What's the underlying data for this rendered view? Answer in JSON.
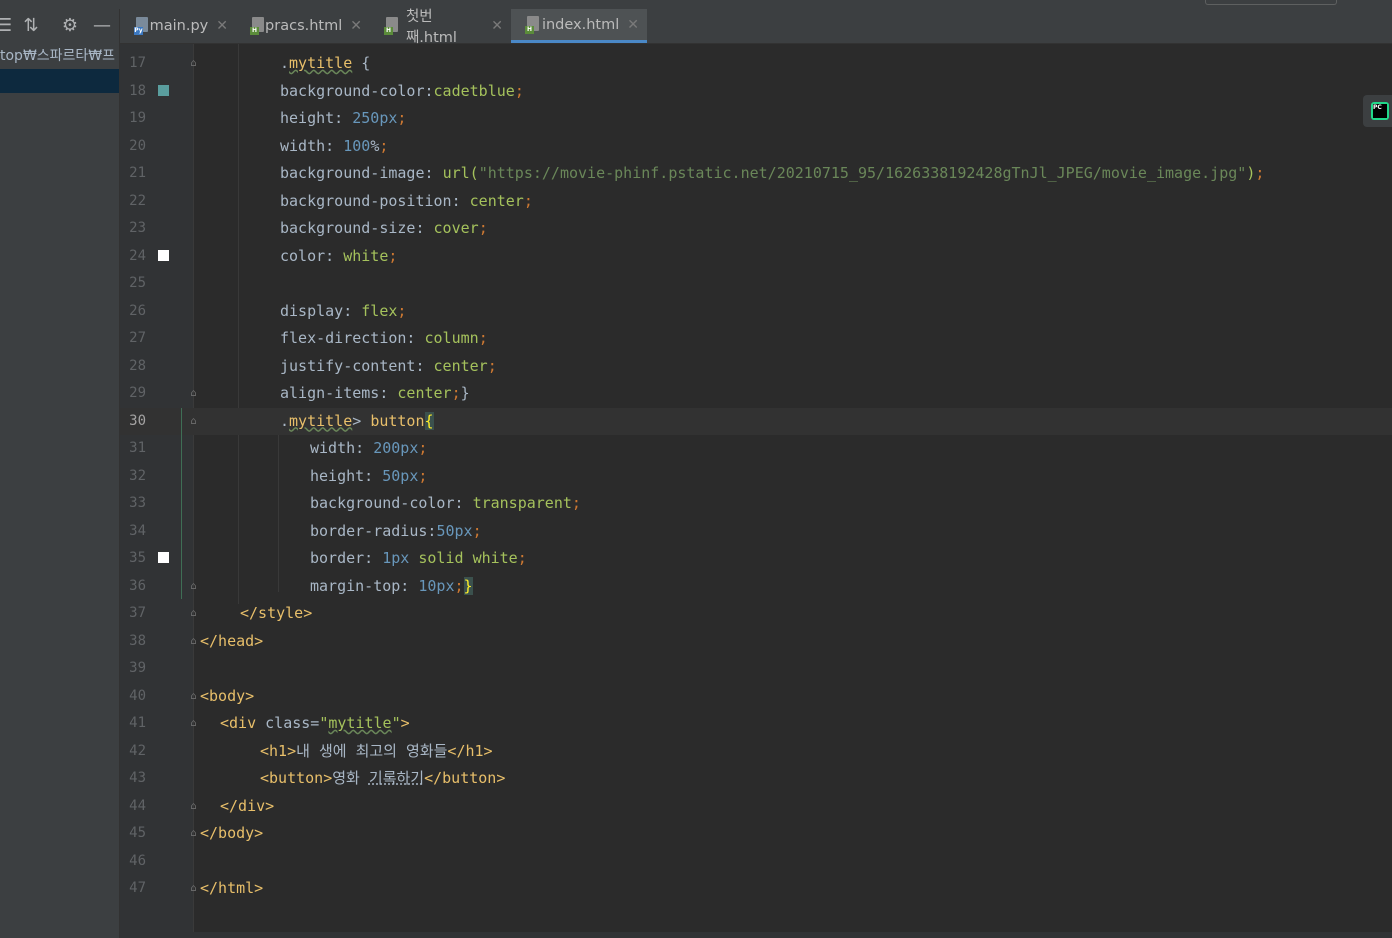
{
  "tabs": [
    {
      "label": "main.py",
      "type": "python",
      "active": false
    },
    {
      "label": "pracs.html",
      "type": "html",
      "active": false
    },
    {
      "label": "첫번째.html",
      "type": "html",
      "active": false
    },
    {
      "label": "index.html",
      "type": "html",
      "active": true
    }
  ],
  "left_panel": {
    "path_text": "top₩스파르타₩프",
    "tools": [
      "expand-all-icon",
      "collapse-all-icon",
      "gear-icon",
      "minimize-icon"
    ]
  },
  "editor": {
    "current_line": 30,
    "lines": [
      {
        "n": "17",
        "html": ".<span class='sel'>mytitle</span> {"
      },
      {
        "n": "18",
        "marker": "#5a9e9e",
        "html": "background-color:<span class='val'>cadetblue</span><span class='kw'>;</span>"
      },
      {
        "n": "19",
        "html": "height: <span class='num'>250px</span><span class='kw'>;</span>"
      },
      {
        "n": "20",
        "html": "width: <span class='num'>100</span>%<span class='kw'>;</span>"
      },
      {
        "n": "21",
        "html": "background-image: <span class='val'>url(</span><span class='str'>\"https://movie-phinf.pstatic.net/20210715_95/1626338192428gTnJl_JPEG/movie_image.jpg\"</span><span class='val'>)</span><span class='kw'>;</span>"
      },
      {
        "n": "22",
        "html": "background-position: <span class='val'>center</span><span class='kw'>;</span>"
      },
      {
        "n": "23",
        "html": "background-size: <span class='val'>cover</span><span class='kw'>;</span>"
      },
      {
        "n": "24",
        "marker": "#ffffff",
        "html": "color: <span class='val'>white</span><span class='kw'>;</span>"
      },
      {
        "n": "25",
        "html": ""
      },
      {
        "n": "26",
        "html": "display: <span class='val'>flex</span><span class='kw'>;</span>"
      },
      {
        "n": "27",
        "html": "flex-direction: <span class='val'>column</span><span class='kw'>;</span>"
      },
      {
        "n": "28",
        "html": "justify-content: <span class='val'>center</span><span class='kw'>;</span>"
      },
      {
        "n": "29",
        "html": "align-items: <span class='val'>center</span><span class='kw'>;</span>}"
      },
      {
        "n": "30",
        "html": ".<span class='sel'>mytitle</span>&gt; <span class='tag'>button</span><span class='brace-hl'>{</span>"
      },
      {
        "n": "31",
        "html": "width: <span class='num'>200px</span><span class='kw'>;</span>"
      },
      {
        "n": "32",
        "html": "height: <span class='num'>50px</span><span class='kw'>;</span>"
      },
      {
        "n": "33",
        "html": "background-color: <span class='val'>transparent</span><span class='kw'>;</span>"
      },
      {
        "n": "34",
        "html": "border-radius:<span class='num'>50px</span><span class='kw'>;</span>"
      },
      {
        "n": "35",
        "marker": "#ffffff",
        "html": "border: <span class='num'>1px</span> <span class='val'>solid</span> <span class='val'>white</span><span class='kw'>;</span>"
      },
      {
        "n": "36",
        "html": "margin-top: <span class='num'>10px</span><span class='kw'>;</span><span class='brace-hl'>}</span>"
      },
      {
        "n": "37",
        "html": "<span class='tag'>&lt;/style&gt;</span>"
      },
      {
        "n": "38",
        "html": "<span class='tag'>&lt;/head&gt;</span>"
      },
      {
        "n": "39",
        "html": ""
      },
      {
        "n": "40",
        "html": "<span class='tag'>&lt;body&gt;</span>"
      },
      {
        "n": "41",
        "html": "<span class='tag'>&lt;div </span><span class='cls'>class=</span><span class='val'>\"<span class='sel' style='color:#a5c25c'>mytitle</span>\"</span><span class='tag'>&gt;</span>"
      },
      {
        "n": "42",
        "html": "<span class='tag'>&lt;h1&gt;</span><span class='txt'>내 생에 최고의 영화들</span><span class='tag'>&lt;/h1&gt;</span>"
      },
      {
        "n": "43",
        "html": "<span class='tag'>&lt;button&gt;</span><span class='txt'>영화 <span style='text-decoration:underline;text-decoration-style:dotted'>기록하기</span></span><span class='tag'>&lt;/button&gt;</span>"
      },
      {
        "n": "44",
        "html": "<span class='tag'>&lt;/div&gt;</span>"
      },
      {
        "n": "45",
        "html": "<span class='tag'>&lt;/body&gt;</span>"
      },
      {
        "n": "46",
        "html": ""
      },
      {
        "n": "47",
        "html": "<span class='tag'>&lt;/html&gt;</span>"
      }
    ]
  }
}
